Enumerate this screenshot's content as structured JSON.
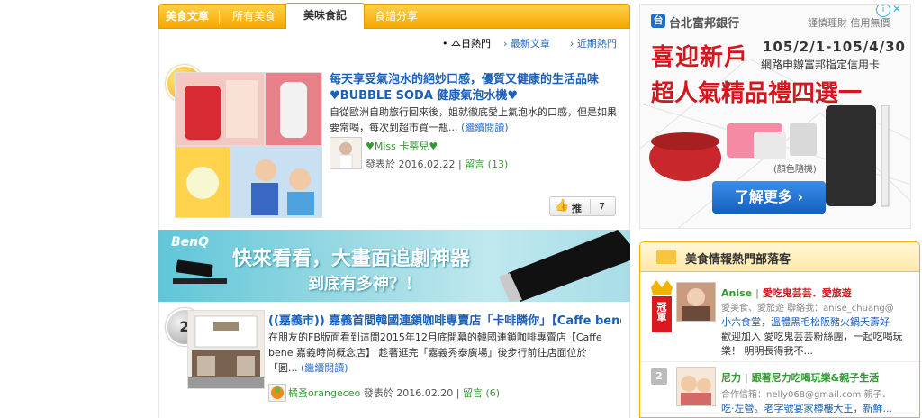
{
  "tabs": {
    "section_label": "美食文章",
    "items": [
      "所有美食",
      "美味食記",
      "食譜分享"
    ],
    "active": "美味食記"
  },
  "subnav": {
    "today": "本日熱門",
    "latest": "最新文章",
    "recent": "近期熱門"
  },
  "articles": [
    {
      "rank": "1",
      "title": "每天享受氣泡水的絕妙口感，優質又健康的生活品味♥BUBBLE SODA 健康氣泡水機♥",
      "excerpt": "自從歐洲自助旅行回來後，姐就徹底愛上氣泡水的口感，但是如果要常喝，每次到超市買一瓶...",
      "read_more": "(繼續閱讀)",
      "author": "♥Miss 卡蒂兒♥",
      "date": "發表於 2016.02.22",
      "comments": "留言 (13)",
      "like_label": "推",
      "like_count": "7"
    },
    {
      "rank": "2",
      "title": "((嘉義市)) 嘉義首間韓國連鎖咖啡專賣店「卡啡隣你」【Caffe bene...",
      "excerpt": "在朋友的FB版面看到這間2015年12月底開幕的韓國連鎖咖啡專賣店【Caffe bene 嘉義時尚概念店】 趁著逛完「嘉義秀泰廣場」後步行前往店面位於「圓...",
      "read_more": "(繼續閱讀)",
      "author": "橘蚤orangeceo",
      "date": "發表於 2016.02.20",
      "comments": "留言 (6)"
    }
  ],
  "banner": {
    "brand": "BenQ",
    "headline": "快來看看，大畫面追劇神器",
    "subline": "到底有多神？！"
  },
  "ad": {
    "bank": "台北富邦銀行",
    "links": "謹慎理財 信用無價",
    "dates": "105/2/1-105/4/30",
    "note": "網路申辦富邦指定信用卡",
    "headline1": "喜迎新戶",
    "headline2": "超人氣精品禮四選一",
    "color_note": "(顏色隨機)",
    "cta": "了解更多 ›"
  },
  "panel": {
    "title": "美食情報熱門部落客",
    "bloggers": [
      {
        "rank_label": "冠軍",
        "name": "Anise",
        "blog": "愛吃鬼芸芸．愛旅遊",
        "tags": "愛美食、愛旅遊 聯絡我：anise_chuang@",
        "line1": "小六食堂，溫體黑毛松阪豬火鍋夭壽好",
        "line2": "歡迎加入 愛吃鬼芸芸粉絲團，一起吃喝玩",
        "line3": "樂！ 明明長得我不..."
      },
      {
        "rank_label": "2",
        "name": "尼力",
        "blog": "跟著尼力吃喝玩樂&親子生活",
        "tags": "合作信箱：nelly068@gmail.com 親子．",
        "line1": "吃‧左營。老字號宴家樽樓大王，新鮮..."
      }
    ]
  },
  "colors": {
    "accent": "#f6a800",
    "link": "#1a5fb8",
    "ad_red": "#d6161f"
  }
}
